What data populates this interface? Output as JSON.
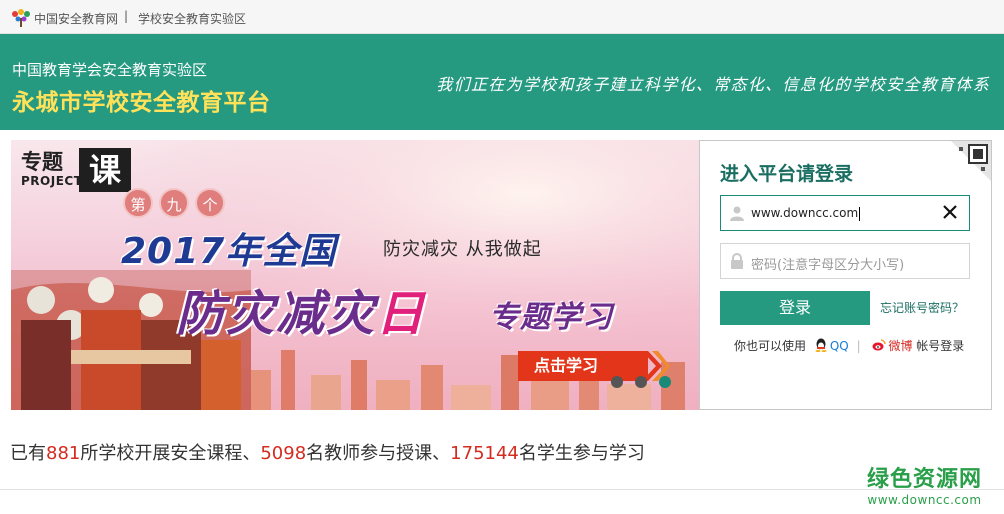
{
  "topbar": {
    "site_name": "中国安全教育网",
    "separator": "|",
    "zone_name": "学校安全教育实验区"
  },
  "header": {
    "subtitle": "中国教育学会安全教育实验区",
    "title": "永城市学校安全教育平台",
    "slogan": "我们正在为学校和孩子建立科学化、常态化、信息化的学校安全教育体系"
  },
  "banner": {
    "tag_zt": "专题",
    "tag_project": "PROJECT",
    "tag_ke": "课",
    "circles": [
      "第",
      "九",
      "个"
    ],
    "year_line": "2017年全国",
    "motto": "防灾减灾  从我做起",
    "big_title_main": "防灾减灾",
    "big_title_ri": "日",
    "sub_title": "专题学习",
    "study_button": "点击学习",
    "slides_total": 3,
    "slide_active": 3
  },
  "login": {
    "heading": "进入平台请登录",
    "username_value": "www.downcc.com",
    "password_placeholder": "密码(注意字母区分大小写)",
    "login_button": "登录",
    "forgot_link": "忘记账号密码？",
    "alt_prefix": "你也可以使用",
    "qq_label": "QQ",
    "alt_sep": "|",
    "weibo_label": "微博",
    "alt_suffix": "帐号登录"
  },
  "stats": {
    "t1": "已有",
    "schools": "881",
    "t2": "所学校开展安全课程、",
    "teachers": "5098",
    "t3": "名教师参与授课、",
    "students": "175144",
    "t4": "名学生参与学习"
  },
  "watermark": {
    "line1": "绿色资源网",
    "line2": "www.downcc.com"
  },
  "colors": {
    "brand_green": "#259a81",
    "title_yellow": "#ffe259",
    "stat_red": "#d42b1f",
    "heading_green": "#1a6e61"
  }
}
